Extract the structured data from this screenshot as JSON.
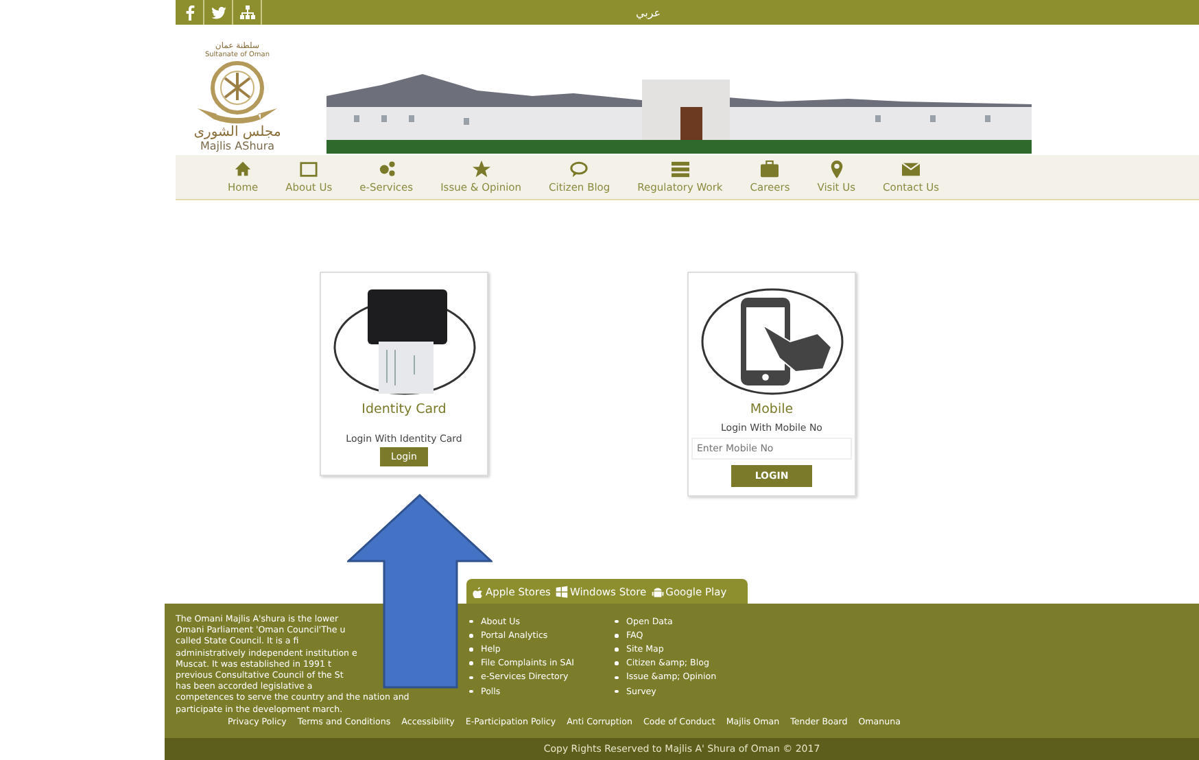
{
  "top_bar": {
    "language": "عربي"
  },
  "logo": {
    "country_ar": "سلطنة عمان",
    "country_en": "Sultanate of Oman",
    "name_ar": "مجلس الشورى",
    "name_en": "Majlis AShura"
  },
  "nav": [
    {
      "label": "Home"
    },
    {
      "label": "About Us"
    },
    {
      "label": "e-Services"
    },
    {
      "label": "Issue & Opinion"
    },
    {
      "label": "Citizen Blog"
    },
    {
      "label": "Regulatory Work"
    },
    {
      "label": "Careers"
    },
    {
      "label": "Visit Us"
    },
    {
      "label": "Contact Us"
    }
  ],
  "login_cards": [
    {
      "kind": "card",
      "title": "Identity Card",
      "caption": "Login With Identity Card",
      "button": "Login"
    },
    {
      "kind": "mobile",
      "title": "Mobile",
      "caption": "Login With Mobile No",
      "placeholder": "Enter Mobile No",
      "button": "LOGIN"
    }
  ],
  "store_tabs": [
    "Apple Stores",
    "Windows Store",
    "Google Play"
  ],
  "footer": {
    "about_lines": [
      "The Omani Majlis A'shura is the lower",
      "Omani Parliament 'Oman Council'The u",
      "called State Council. It is a fi",
      "administratively independent institution e",
      "Muscat. It was established in 1991 t",
      "previous Consultative Council of the St",
      "has been accorded legislative a",
      "competences to serve the country and the nation and",
      "participate in the development march."
    ],
    "links_1": [
      "About Us",
      "Portal Analytics",
      "Help",
      "File Complaints in SAI",
      "e-Services Directory",
      "Polls"
    ],
    "links_2": [
      "Open Data",
      "FAQ",
      "Site Map",
      "Citizen &amp; Blog",
      "Issue &amp; Opinion",
      "Survey"
    ],
    "bottom_links": [
      "Privacy Policy",
      "Terms and Conditions",
      "Accessibility",
      "E-Participation Policy",
      "Anti Corruption",
      "Code of Conduct",
      "Majlis Oman",
      "Tender Board",
      "Omanuna"
    ],
    "copyright": "Copy Rights Reserved to Majlis A' Shura  of Oman © 2017"
  }
}
